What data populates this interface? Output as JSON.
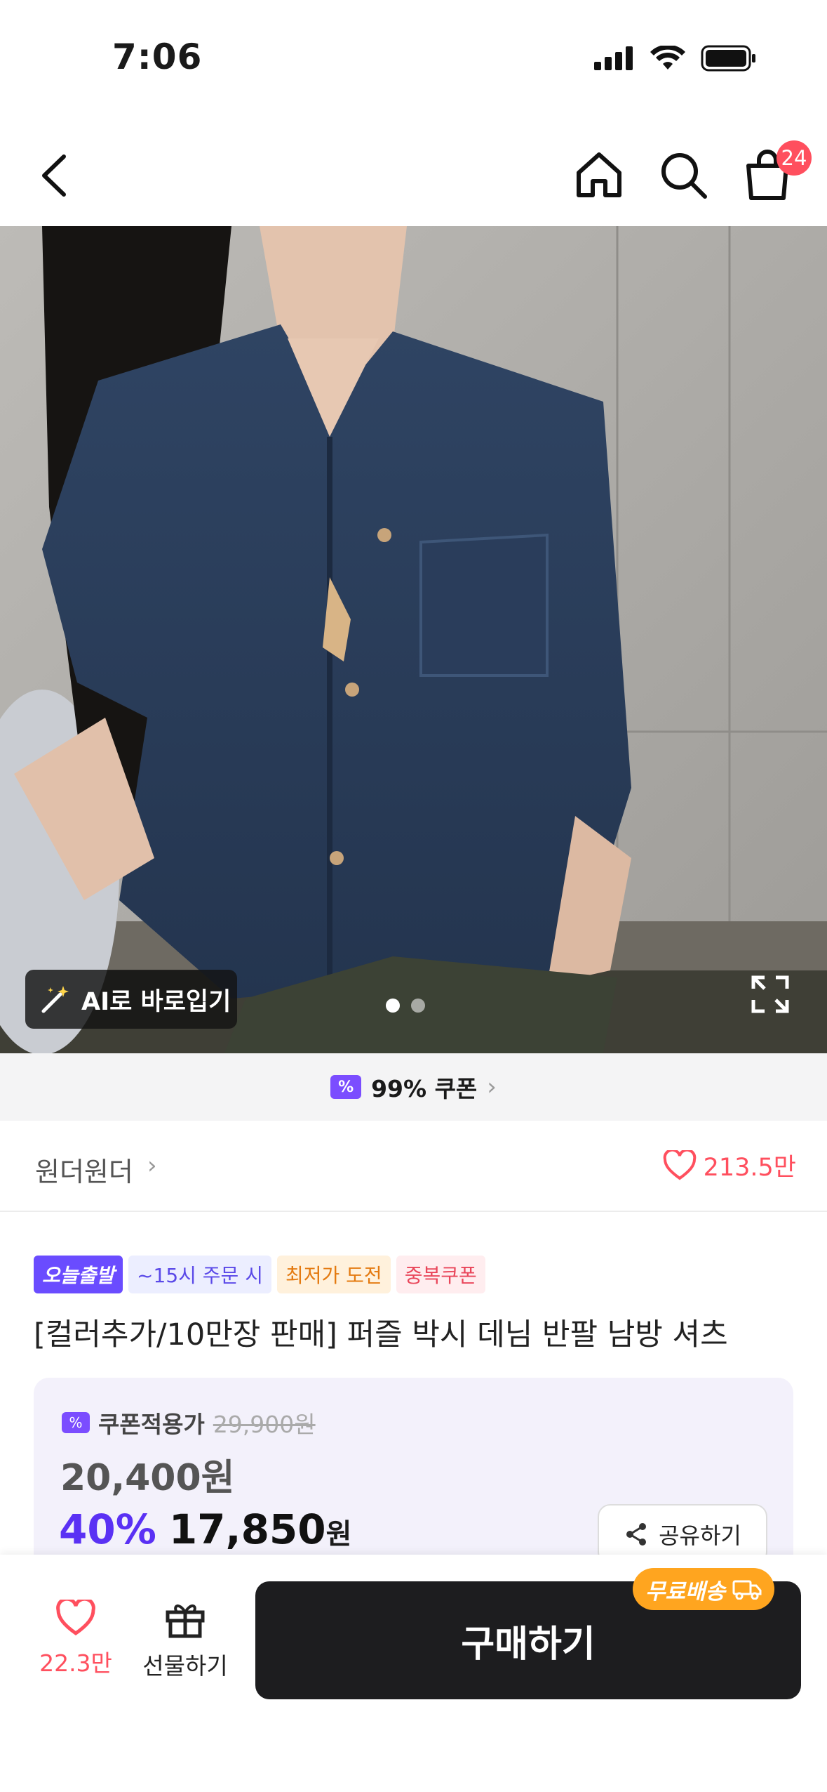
{
  "status": {
    "time": "7:06",
    "icons": [
      "cellular-signal-icon",
      "wifi-icon",
      "battery-icon"
    ]
  },
  "nav": {
    "back_icon": "chevron-left-icon",
    "home_icon": "home-icon",
    "search_icon": "search-icon",
    "cart_icon": "shopping-bag-icon",
    "cart_count": "24"
  },
  "hero": {
    "ai_button_label": "AI로 바로입기",
    "ai_icon": "magic-wand-icon",
    "expand_icon": "expand-icon",
    "page_count": 2,
    "active_page": 1
  },
  "coupon_banner": {
    "label": "99% 쿠폰",
    "icon": "coupon-icon"
  },
  "store": {
    "name": "원더원더",
    "like_count": "213.5만"
  },
  "tags": {
    "today": "오늘출발",
    "time": "~15시 주문 시",
    "lowest": "최저가 도전",
    "duplicate_coupon": "중복쿠폰"
  },
  "product": {
    "title": "[컬러추가/10만장 판매] 퍼즐 박시 데님 반팔 남방 셔츠"
  },
  "price": {
    "coupon_label": "쿠폰적용가",
    "original_price": "29,900원",
    "coupon_price": "20,400원",
    "discount_pct": "40%",
    "final_price": "17,850",
    "currency": "원",
    "share_label": "공유하기"
  },
  "bottom": {
    "like_count": "22.3만",
    "gift_label": "선물하기",
    "buy_label": "구매하기",
    "free_shipping": "무료배송"
  },
  "colors": {
    "accent_purple": "#5a31f4",
    "like_red": "#ff4f5e",
    "free_ship_orange": "#ffa51f",
    "buy_button": "#1d1d1f"
  }
}
